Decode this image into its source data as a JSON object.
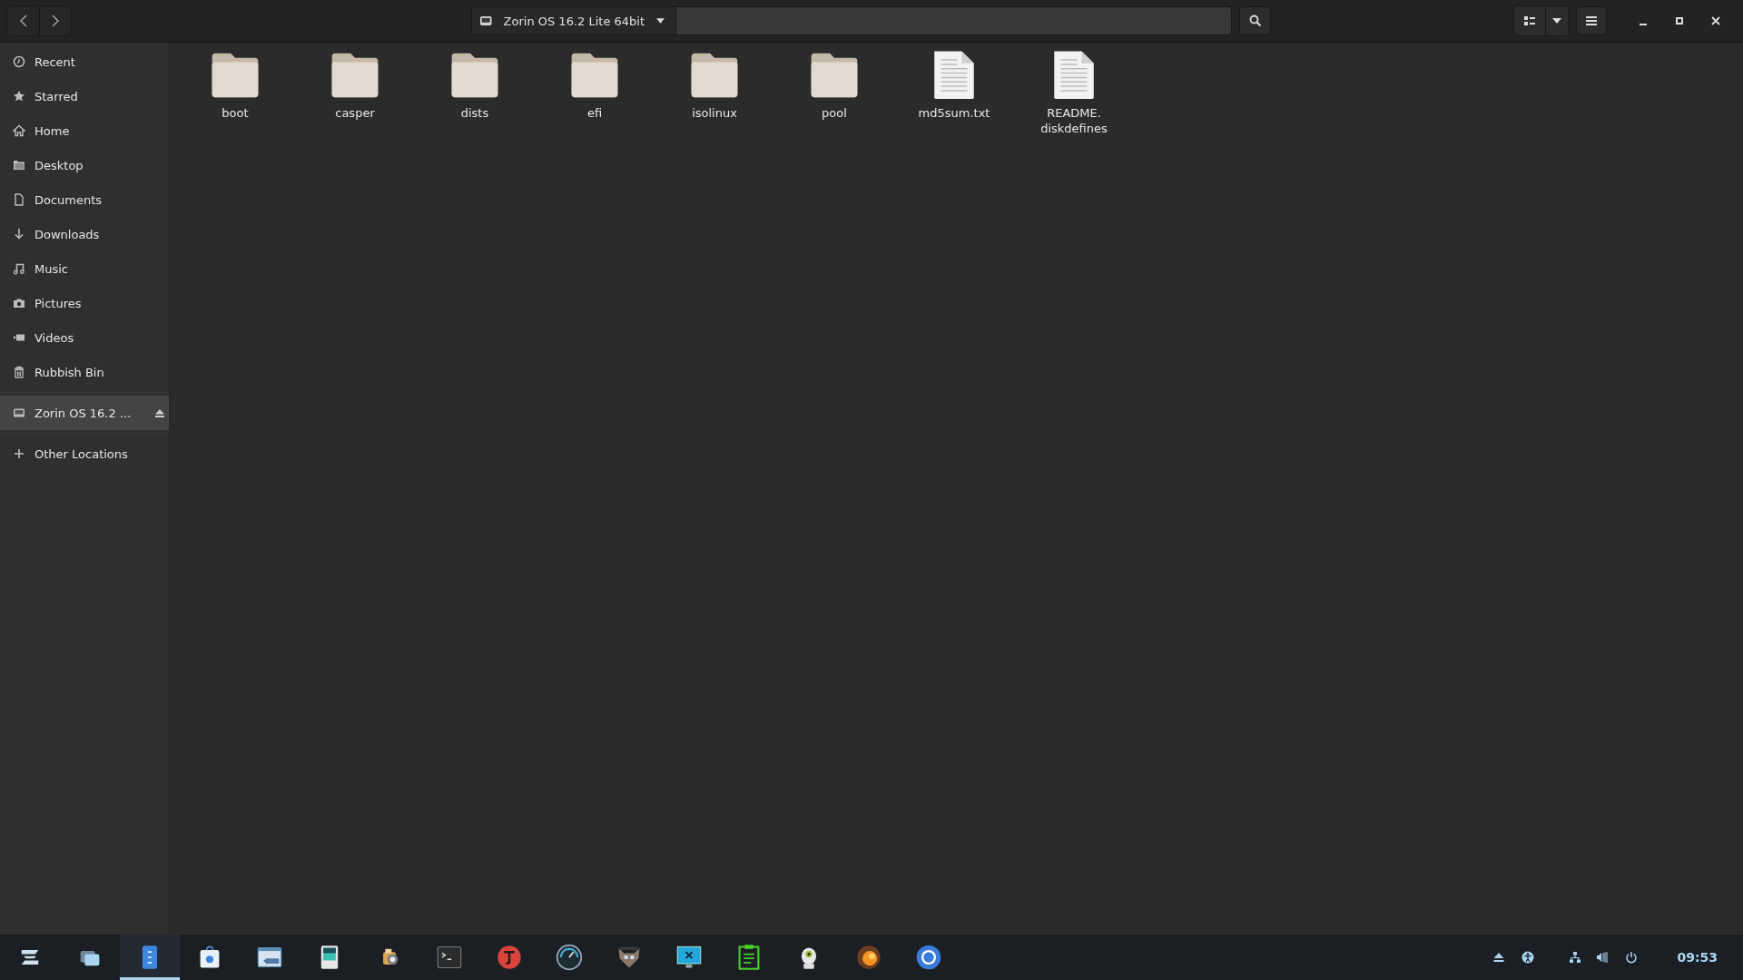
{
  "header": {
    "location": "Zorin OS 16.2 Lite 64bit"
  },
  "sidebar": {
    "places": [
      {
        "kind": "recent",
        "label": "Recent"
      },
      {
        "kind": "star",
        "label": "Starred"
      },
      {
        "kind": "home",
        "label": "Home"
      },
      {
        "kind": "folder",
        "label": "Desktop"
      },
      {
        "kind": "document",
        "label": "Documents"
      },
      {
        "kind": "download",
        "label": "Downloads"
      },
      {
        "kind": "music",
        "label": "Music"
      },
      {
        "kind": "camera",
        "label": "Pictures"
      },
      {
        "kind": "video",
        "label": "Videos"
      },
      {
        "kind": "trash",
        "label": "Rubbish Bin"
      }
    ],
    "devices": [
      {
        "kind": "drive",
        "label": "Zorin OS 16.2 ...",
        "selected": true,
        "ejectable": true
      }
    ],
    "other": [
      {
        "kind": "plus",
        "label": "Other Locations"
      }
    ]
  },
  "files": [
    {
      "kind": "folder",
      "name": "boot"
    },
    {
      "kind": "folder",
      "name": "casper"
    },
    {
      "kind": "folder",
      "name": "dists"
    },
    {
      "kind": "folder",
      "name": "efi"
    },
    {
      "kind": "folder",
      "name": "isolinux"
    },
    {
      "kind": "folder",
      "name": "pool"
    },
    {
      "kind": "text",
      "name": "md5sum.txt"
    },
    {
      "kind": "text",
      "name": "README.\ndiskdefines"
    }
  ],
  "taskbar": {
    "apps": [
      {
        "kind": "zorin-menu",
        "selected": false
      },
      {
        "kind": "windows",
        "selected": false
      },
      {
        "kind": "files",
        "selected": true
      },
      {
        "kind": "store",
        "selected": false
      },
      {
        "kind": "remote",
        "selected": false
      },
      {
        "kind": "viewer",
        "selected": false
      },
      {
        "kind": "package",
        "selected": false
      },
      {
        "kind": "terminal",
        "selected": false
      },
      {
        "kind": "font",
        "selected": false
      },
      {
        "kind": "gauge",
        "selected": false
      },
      {
        "kind": "mascot",
        "selected": false
      },
      {
        "kind": "screen",
        "selected": false
      },
      {
        "kind": "notes",
        "selected": false
      },
      {
        "kind": "alien",
        "selected": false
      },
      {
        "kind": "swirl",
        "selected": false
      },
      {
        "kind": "browser",
        "selected": false
      }
    ],
    "tray": [
      {
        "kind": "eject"
      },
      {
        "kind": "accessibility"
      },
      {
        "kind": "network"
      },
      {
        "kind": "volume"
      },
      {
        "kind": "power"
      }
    ],
    "clock": "09:53"
  }
}
